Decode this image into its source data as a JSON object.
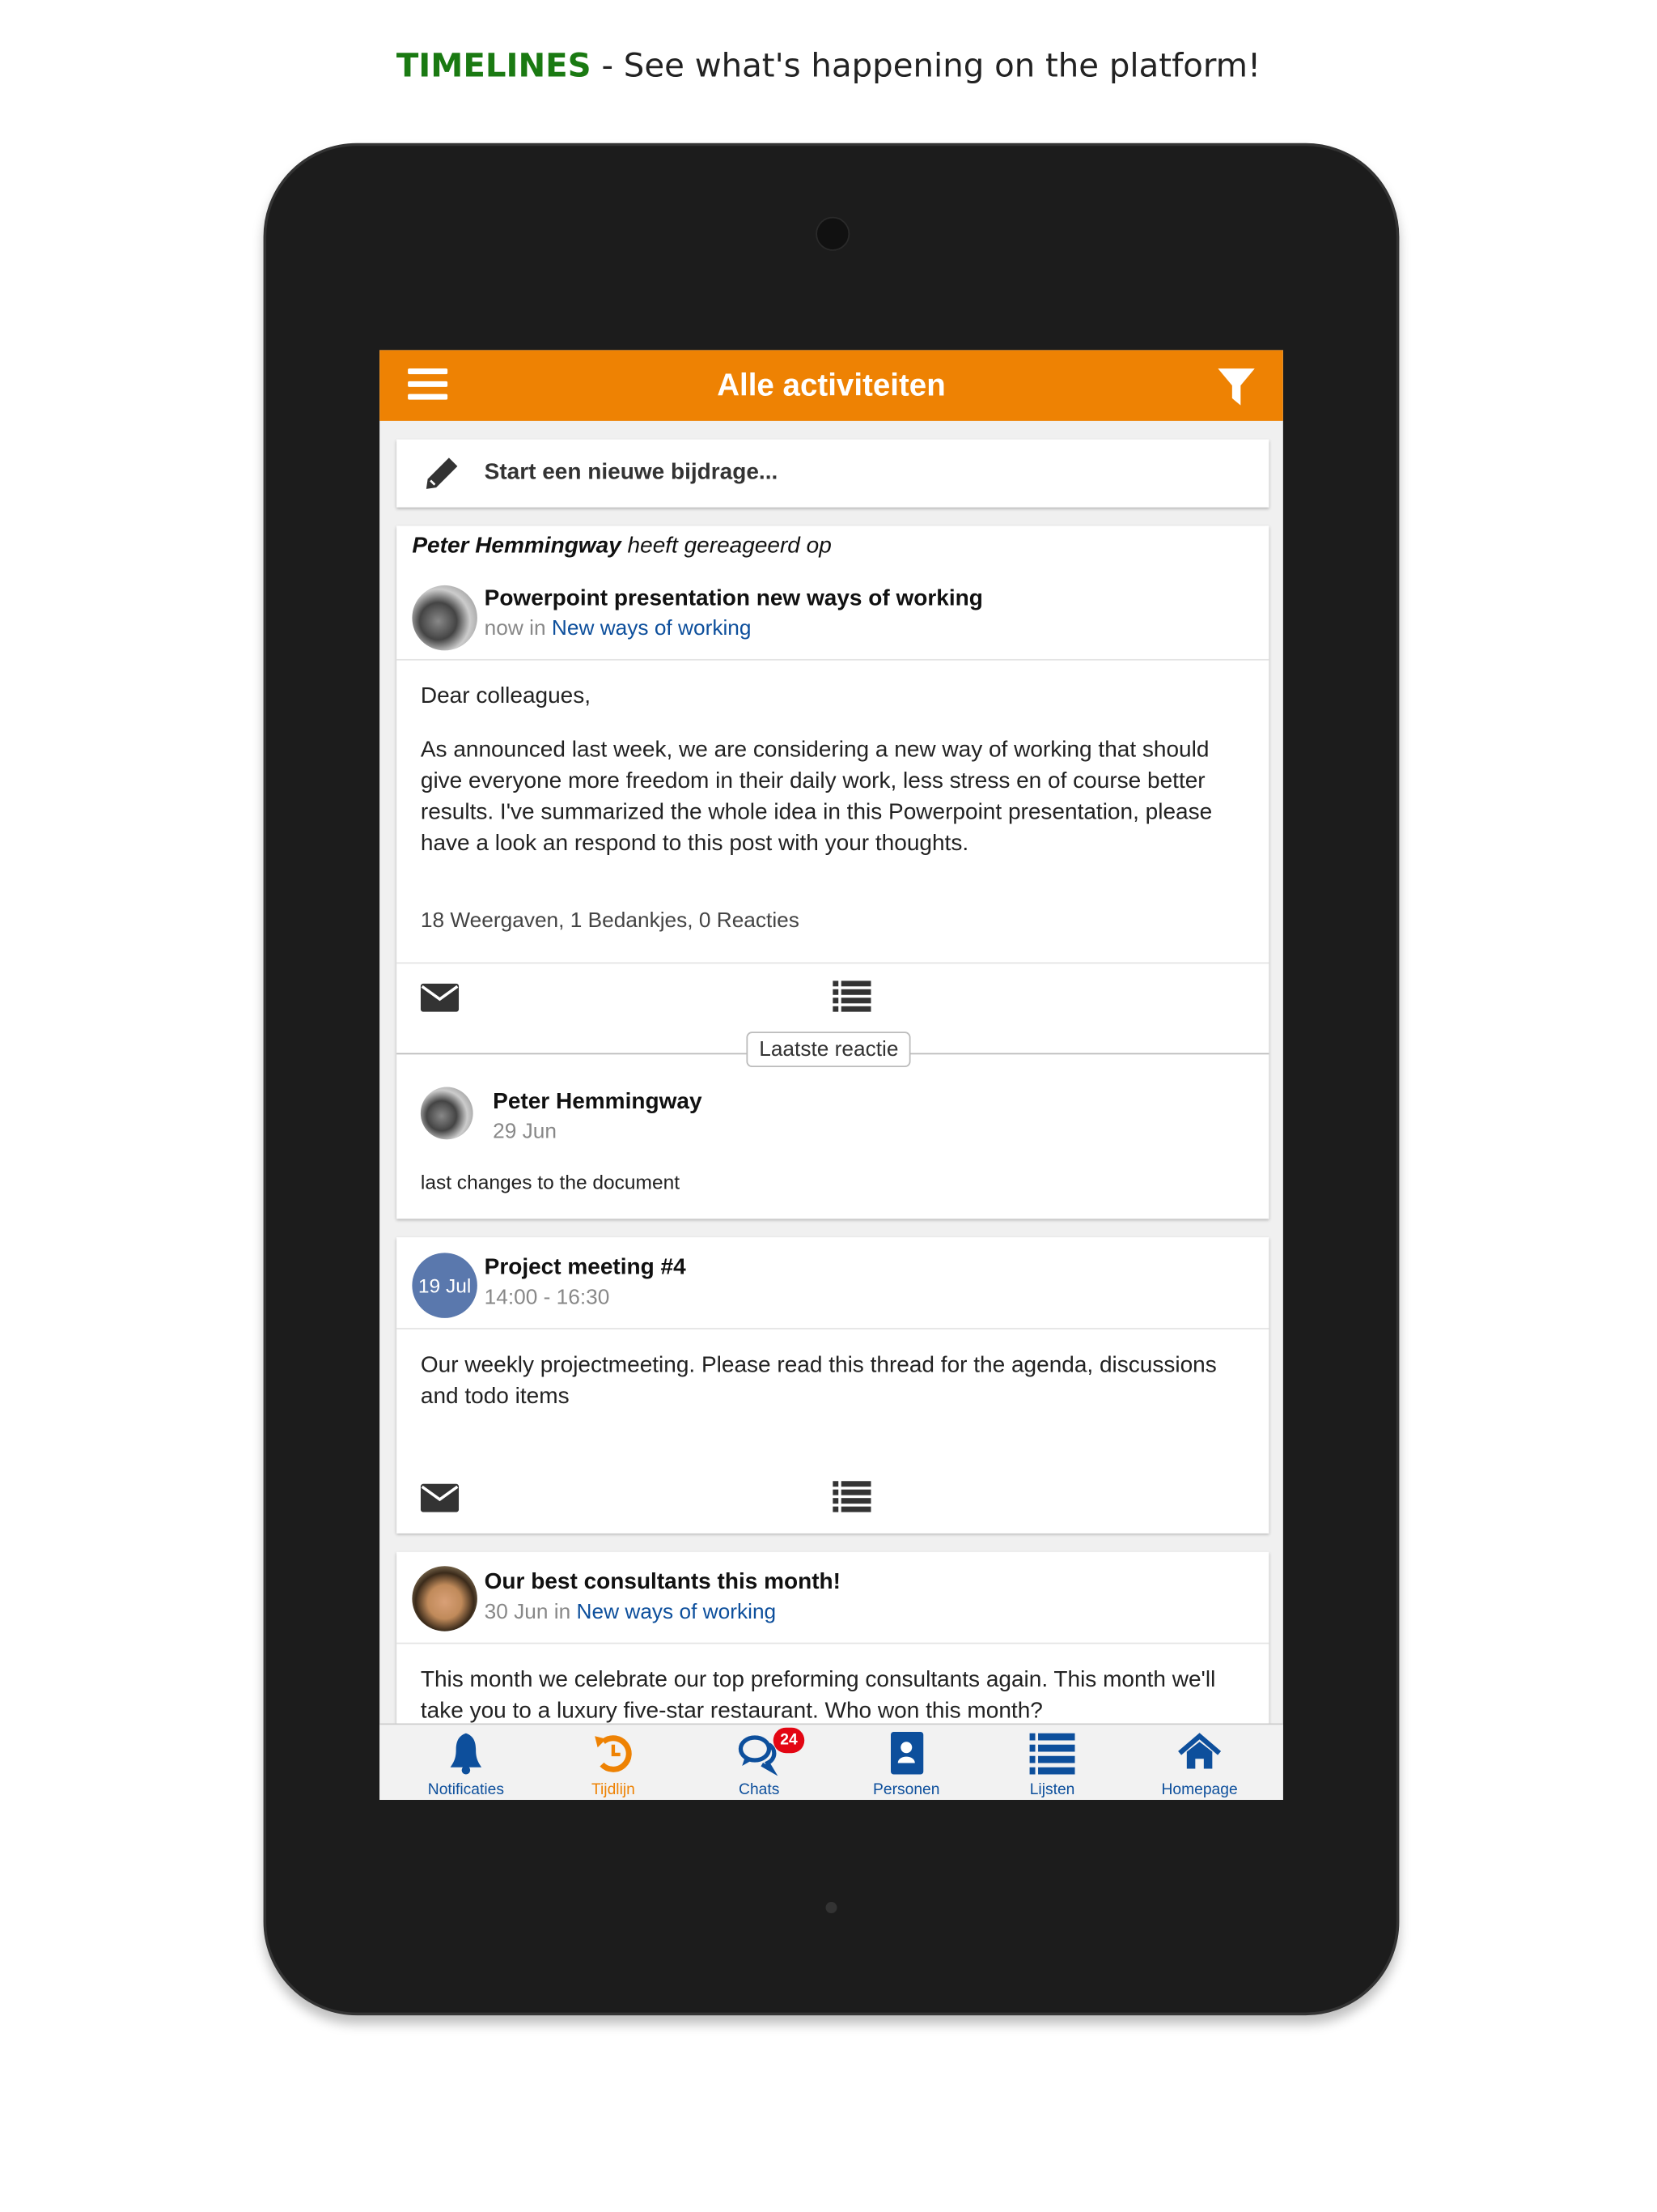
{
  "caption": {
    "highlight": "TIMELINES",
    "rest": " - See what's happening on the platform!"
  },
  "colors": {
    "accent": "#ee8203",
    "link": "#0d4f9c",
    "caption_green": "#1a7a12",
    "badge": "#e30613"
  },
  "header": {
    "title": "Alle activiteiten",
    "menu_icon": "hamburger-icon",
    "filter_icon": "filter-icon"
  },
  "compose": {
    "label": "Start een nieuwe bijdrage..."
  },
  "posts": [
    {
      "actor": "Peter Hemmingway",
      "action": "heeft gereageerd op",
      "title": "Powerpoint presentation new ways of working",
      "time": "now",
      "in": "in",
      "group": "New ways of working",
      "greeting": "Dear colleagues,",
      "body": "As announced last week, we are considering a new way of working that should give everyone more freedom in their daily work, less stress en of course better results. I've summarized the whole idea in this Powerpoint presentation, please have a look an respond to this post with your thoughts.",
      "stats": "18 Weergaven, 1 Bedankjes, 0 Reacties",
      "last_reaction_label": "Laatste reactie",
      "reaction": {
        "author": "Peter Hemmingway",
        "date": "29 Jun",
        "text": "last changes to the document"
      }
    },
    {
      "date_badge": "19 Jul",
      "title": "Project meeting #4",
      "time": "14:00 - 16:30",
      "body": "Our weekly projectmeeting. Please read this thread for the agenda, discussions and todo items"
    },
    {
      "title": "Our best consultants this month!",
      "time": "30 Jun",
      "in": "in",
      "group": "New ways of working",
      "body": "This month we celebrate our top preforming consultants again. This month we'll take you to a luxury five-star restaurant. Who won this month?"
    }
  ],
  "nav": [
    {
      "label": "Notificaties",
      "icon": "bell-icon"
    },
    {
      "label": "Tijdlijn",
      "icon": "history-icon",
      "active": true
    },
    {
      "label": "Chats",
      "icon": "chat-icon",
      "badge": "24"
    },
    {
      "label": "Personen",
      "icon": "address-book-icon"
    },
    {
      "label": "Lijsten",
      "icon": "list-icon"
    },
    {
      "label": "Homepage",
      "icon": "home-icon"
    }
  ]
}
